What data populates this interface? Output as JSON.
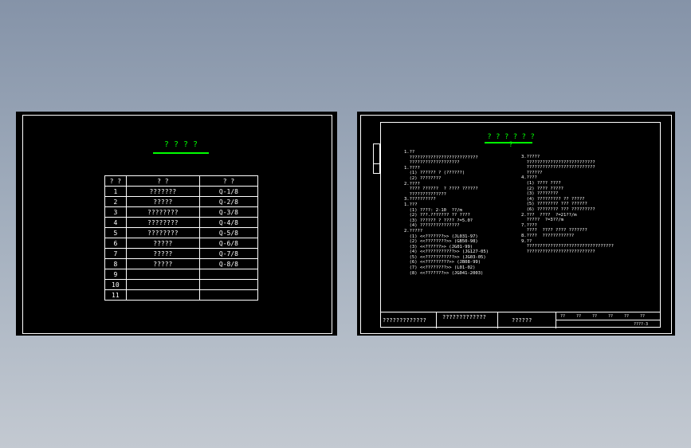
{
  "left_sheet": {
    "title": "? ? ? ?",
    "table": {
      "headers": [
        "? ?",
        "? ?",
        "? ?"
      ],
      "rows": [
        [
          "1",
          "???????",
          "Q-1/8"
        ],
        [
          "2",
          "?????",
          "Q-2/8"
        ],
        [
          "3",
          "????????",
          "Q-3/8"
        ],
        [
          "4",
          "????????",
          "Q-4/8"
        ],
        [
          "5",
          "????????",
          "Q-5/8"
        ],
        [
          "6",
          "?????",
          "Q-6/8"
        ],
        [
          "7",
          "?????",
          "Q-7/8"
        ],
        [
          "8",
          "?????",
          "Q-8/8"
        ],
        [
          "9",
          "",
          ""
        ],
        [
          "10",
          "",
          ""
        ],
        [
          "11",
          "",
          ""
        ]
      ]
    }
  },
  "right_sheet": {
    "title": "? ? ? ? ? ? ?",
    "left_col": [
      "1.??",
      "  ??????????????????????????",
      "  ???????????????????",
      "1.????",
      "  (1) ?????? ? (??????)",
      "  (2) ????????",
      "2.????",
      "  ???? ??????  ? ???? ??????",
      "  ??????????????",
      "3.??????????",
      "1.???",
      "  (1) ????: 2-10  ??/m",
      "  (2) ???.??????? ?? ????",
      "  (3) ?????? ? ???? ?=5.0?",
      "  (4) ???????????????",
      "2.?????",
      "  (1) <<???????>> (JL031-97)",
      "  (2) <<????????>> (GB50-98)",
      "  (3) <<??????>> (JG01-99)",
      "  (4) <<???????????>> (JG127-05)",
      "  (5) <<???????????>> (JG03-05)",
      "  (6) <<?????????>> (JB08-99)",
      "  (7) <<????????>> (L01-02)",
      "  (8) <<???????>> (JG041-2003)"
    ],
    "right_col": [
      "3.?????",
      "  ??????????????????????????",
      "  ??????????????????????????",
      "  ??????",
      "4.????",
      "  (1) ???? ????",
      "  (2) ???? ?????",
      "  (3) ????????",
      "  (4) ????????? ?? ?????",
      "  (5) ???????? ??? ??????",
      "  (6) ???????? ??? ?????????",
      "2.???  ????  ?=21??/m",
      "  ?????  ?=3??/m",
      "7.????",
      "  ????  ???? ???? ???????",
      "8.????  ????????????",
      "9.??",
      "  ?????????????????????????????????",
      "  ??????????????????????????"
    ],
    "title_block": {
      "cells": [
        "?????????????",
        "?????????????",
        "??????",
        "??",
        "??",
        "??",
        "??",
        "??",
        "??"
      ],
      "sheet_no": "????-3"
    }
  }
}
